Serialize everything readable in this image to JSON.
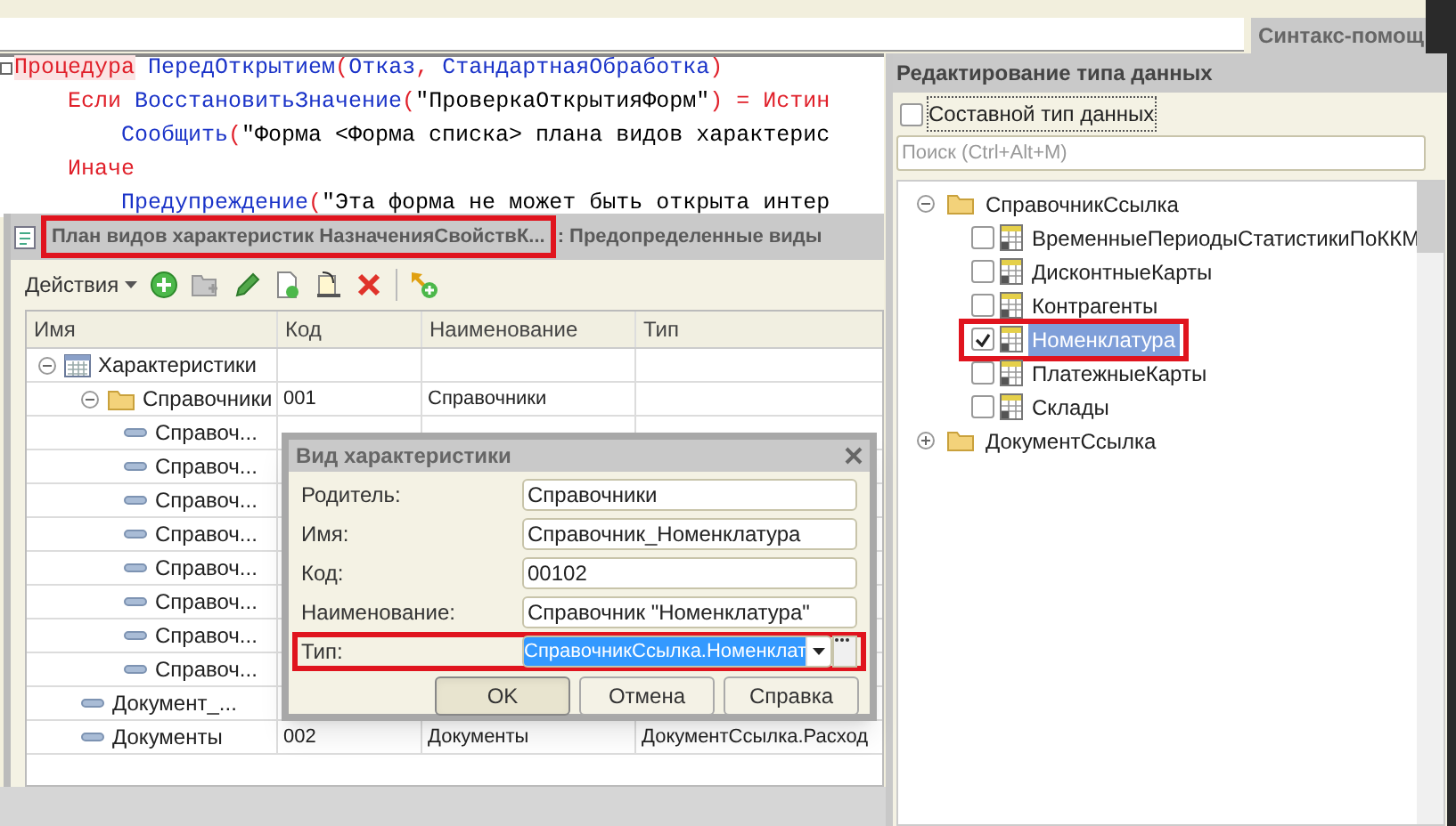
{
  "top_tab": {
    "label": "Синтакс-помощ"
  },
  "code_lines": [
    {
      "tokens": [
        {
          "kind": "keyword",
          "text": "Процедура"
        },
        {
          "kind": "ident",
          "text": " ПередОткрытием"
        },
        {
          "kind": "op",
          "text": "("
        },
        {
          "kind": "ident",
          "text": "Отказ"
        },
        {
          "kind": "op",
          "text": ", "
        },
        {
          "kind": "ident",
          "text": "СтандартнаяОбработка"
        },
        {
          "kind": "op",
          "text": ")"
        }
      ],
      "children": [
        {
          "tokens": [
            {
              "kind": "keyword",
              "text": "Если"
            },
            {
              "kind": "ident",
              "text": " ВосстановитьЗначение"
            },
            {
              "kind": "op",
              "text": "("
            },
            {
              "kind": "string",
              "text": "\"ПроверкаОткрытияФорм\""
            },
            {
              "kind": "op",
              "text": ") = "
            },
            {
              "kind": "keyword",
              "text": "Истин"
            }
          ],
          "children": [
            {
              "tokens": [
                {
                  "kind": "ident",
                  "text": "Сообщить"
                },
                {
                  "kind": "op",
                  "text": "("
                },
                {
                  "kind": "string",
                  "text": "\"Форма <Форма списка> плана видов характерис"
                }
              ]
            }
          ]
        },
        {
          "tokens": [
            {
              "kind": "keyword",
              "text": "Иначе"
            }
          ],
          "children": [
            {
              "tokens": [
                {
                  "kind": "ident",
                  "text": "Предупреждение"
                },
                {
                  "kind": "op",
                  "text": "("
                },
                {
                  "kind": "string",
                  "text": "\"Эта форма не может быть открыта интер"
                }
              ]
            }
          ]
        }
      ]
    }
  ],
  "list_window": {
    "title": "План видов характеристик НазначенияСвойствК...",
    "title_annotated": true,
    "subtitle": ": Предопределенные виды",
    "actions_label": "Действия",
    "columns": [
      "Имя",
      "Код",
      "Наименование",
      "Тип"
    ],
    "rows": [
      {
        "kind": "table",
        "name": "Характеристики",
        "expanded": true,
        "children": [
          {
            "kind": "folder",
            "name": "Справочники",
            "code": "001",
            "title": "Справочники",
            "expanded": true,
            "children": [
              {
                "kind": "item",
                "name": "Справоч..."
              },
              {
                "kind": "item",
                "name": "Справоч..."
              },
              {
                "kind": "item",
                "name": "Справоч..."
              },
              {
                "kind": "item",
                "name": "Справоч..."
              },
              {
                "kind": "item",
                "name": "Справоч..."
              },
              {
                "kind": "item",
                "name": "Справоч..."
              },
              {
                "kind": "item",
                "name": "Справоч..."
              },
              {
                "kind": "item",
                "name": "Справоч..."
              }
            ]
          },
          {
            "kind": "item",
            "name": "Документ_..."
          },
          {
            "kind": "item",
            "name": "Документы",
            "code": "002",
            "title": "Документы",
            "type": "ДокументСсылка.Расход"
          }
        ]
      }
    ]
  },
  "dialog": {
    "title": "Вид характеристики",
    "fields": [
      {
        "kind": "text",
        "label": "Родитель:",
        "value": "Справочники",
        "annotated": false
      },
      {
        "kind": "text",
        "label": "Имя:",
        "value": "Справочник_Номенклатура",
        "annotated": false
      },
      {
        "kind": "text",
        "label": "Код:",
        "value": "00102",
        "annotated": false
      },
      {
        "kind": "text",
        "label": "Наименование:",
        "value": "Справочник \"Номенклатура\"",
        "annotated": false
      },
      {
        "kind": "select",
        "label": "Тип:",
        "value": "СправочникСсылка.Номенклат",
        "annotated": true
      }
    ],
    "buttons": [
      {
        "label": "OK",
        "default": true
      },
      {
        "label": "Отмена",
        "default": false
      },
      {
        "label": "Справка",
        "default": false
      }
    ]
  },
  "type_panel": {
    "title": "Редактирование типа данных",
    "composite": {
      "label": "Составной тип данных",
      "checked": false
    },
    "search": {
      "placeholder": "Поиск (Ctrl+Alt+M)"
    },
    "tree": [
      {
        "kind": "folder",
        "label": "СправочникСсылка",
        "expanded": true,
        "children": [
          {
            "kind": "type",
            "label": "ВременныеПериодыСтатистикиПоККМ",
            "checked": false,
            "selected": false,
            "annotated": false
          },
          {
            "kind": "type",
            "label": "ДисконтныеКарты",
            "checked": false,
            "selected": false,
            "annotated": false
          },
          {
            "kind": "type",
            "label": "Контрагенты",
            "checked": false,
            "selected": false,
            "annotated": false
          },
          {
            "kind": "type",
            "label": "Номенклатура",
            "checked": true,
            "selected": true,
            "annotated": true
          },
          {
            "kind": "type",
            "label": "ПлатежныеКарты",
            "checked": false,
            "selected": false,
            "annotated": false
          },
          {
            "kind": "type",
            "label": "Склады",
            "checked": false,
            "selected": false,
            "annotated": false
          }
        ]
      },
      {
        "kind": "folder",
        "label": "ДокументСсылка",
        "expanded": false
      }
    ]
  }
}
